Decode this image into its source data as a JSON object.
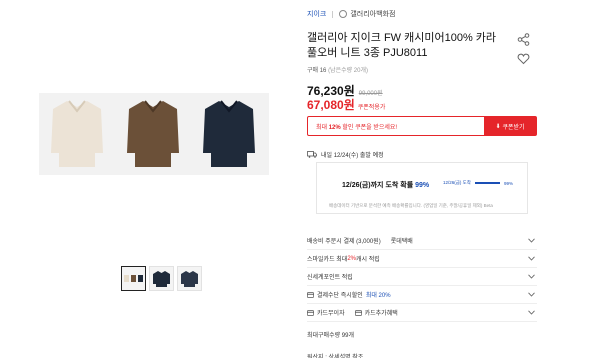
{
  "brand": {
    "name": "지이크",
    "store": "갤러리아백화점"
  },
  "product": {
    "title": "갤러리아 지이크 FW 캐시미어100% 카라 풀오버 니트 3종 PJU8011"
  },
  "purchase": {
    "label": "구매 16",
    "limit": "(남은수량 20개)"
  },
  "price": {
    "sale": "76,230원",
    "original": "99,000원",
    "coupon_price": "67,080원",
    "coupon_note": "쿠폰적용가"
  },
  "coupon": {
    "prefix": "최대 ",
    "percent": "12%",
    "suffix": " 할인 쿠폰을 받으세요!",
    "button": "쿠폰받기"
  },
  "delivery": {
    "label": "내일 12/24(수) 출발 예정",
    "box_title_prefix": "12/26(금)까지 도착 확률 ",
    "probability": "99%",
    "mini_left": "12/26(금) 도착",
    "mini_right": "99%",
    "footnote": "배송데이터 기반으로 분석한 예측 배송확률입니다. (영업일 기준, 주말/공휴일 제외) Beta"
  },
  "rows": [
    {
      "text": "배송비 주문시 결제 (3,000원)",
      "extra": "롯데택배"
    },
    {
      "text": "스마일카드 최대 ",
      "red": "2%",
      "after": " 캐시 적립"
    },
    {
      "text": "신세계포인트 적립"
    },
    {
      "text": "결제수단 즉시할인",
      "blue": "최대 20%"
    },
    {
      "text": "카드무이자",
      "text2": "카드추가혜택"
    }
  ],
  "max_purchase": "최대구매수량 99개",
  "origin": "원산지 : 상세설명 참조",
  "colors": {
    "accent_red": "#e5252a",
    "accent_blue": "#1a4fb5"
  }
}
